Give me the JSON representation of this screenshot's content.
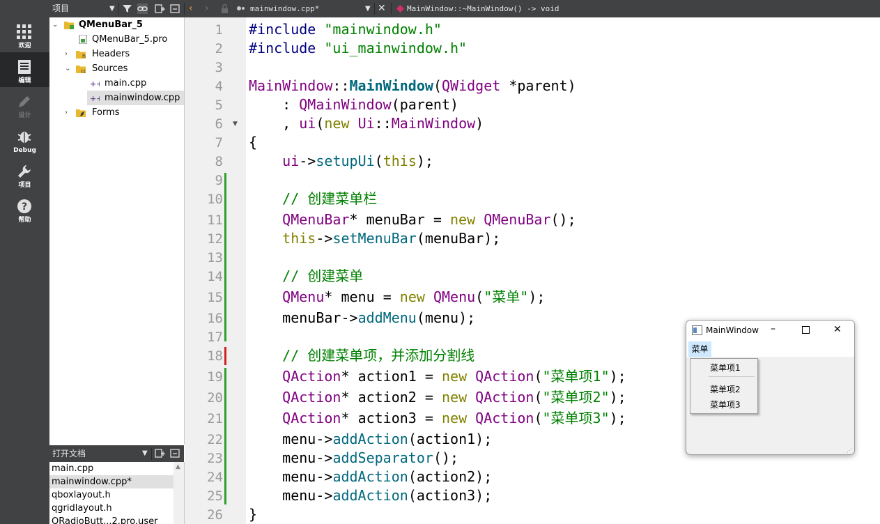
{
  "modes": [
    {
      "label": "欢迎",
      "icon": "grid-icon",
      "active": false
    },
    {
      "label": "编辑",
      "icon": "document-icon",
      "active": true
    },
    {
      "label": "设计",
      "icon": "pencil-icon",
      "active": false
    },
    {
      "label": "Debug",
      "icon": "bug-icon",
      "active": false
    },
    {
      "label": "项目",
      "icon": "wrench-icon",
      "active": false
    },
    {
      "label": "帮助",
      "icon": "help-icon",
      "active": false
    }
  ],
  "topbar": {
    "projects_label": "项目",
    "current_file": "mainwindow.cpp*",
    "symbol": "MainWindow::~MainWindow() -> void"
  },
  "tree": {
    "project": "QMenuBar_5",
    "pro_file": "QMenuBar_5.pro",
    "headers": "Headers",
    "sources": "Sources",
    "main_cpp": "main.cpp",
    "mainwindow_cpp": "mainwindow.cpp",
    "forms": "Forms"
  },
  "open_docs": {
    "title": "打开文档",
    "items": [
      "main.cpp",
      "mainwindow.cpp*",
      "qboxlayout.h",
      "qgridlayout.h",
      "QRadioButt...2.pro.user"
    ]
  },
  "editor": {
    "line_numbers": [
      "1",
      "2",
      "3",
      "4",
      "5",
      "6",
      "7",
      "8",
      "9",
      "10",
      "11",
      "12",
      "13",
      "14",
      "15",
      "16",
      "17",
      "18",
      "19",
      "20",
      "21",
      "22",
      "23",
      "24",
      "25",
      "26"
    ],
    "t": {
      "inc": "#include",
      "h1": "\"mainwindow.h\"",
      "h2": "\"ui_mainwindow.h\"",
      "MainWindow": "MainWindow",
      "MainWindowCtor": "MainWindow",
      "QWidget": "QWidget",
      "parent": "parent",
      "QMainWindow": "QMainWindow",
      "ui": "ui",
      "new": "new",
      "Ui": "Ui",
      "this": "this",
      "setupUi": "setupUi",
      "c1": "// 创建菜单栏",
      "QMenuBar": "QMenuBar",
      "menuBar": "menuBar",
      "setMenuBar": "setMenuBar",
      "c2": "// 创建菜单",
      "QMenu": "QMenu",
      "menu": "menu",
      "s_menu": "\"菜单\"",
      "addMenu": "addMenu",
      "c3": "// 创建菜单项，并添加分割线",
      "QAction": "QAction",
      "action1": "action1",
      "action2": "action2",
      "action3": "action3",
      "s_item1": "\"菜单项1\"",
      "s_item2": "\"菜单项2\"",
      "s_item3": "\"菜单项3\"",
      "addAction": "addAction",
      "addSeparator": "addSeparator",
      "colons": "::",
      "lparen": "(",
      "rparen": ")",
      "star_sp": " *",
      "colon_sp": "    : ",
      "comma_sp": "    , ",
      "lbrace": "{",
      "rbrace": "}",
      "arrow": "->",
      "semi": ";",
      "paren_semi": ");",
      "empty_call": "();",
      "star": "*",
      "eq_new": " = ",
      "indent": "    ",
      "sp": " "
    }
  },
  "window": {
    "title": "MainWindow",
    "menu": "菜单",
    "items": [
      "菜单项1",
      "菜单项2",
      "菜单项3"
    ]
  }
}
